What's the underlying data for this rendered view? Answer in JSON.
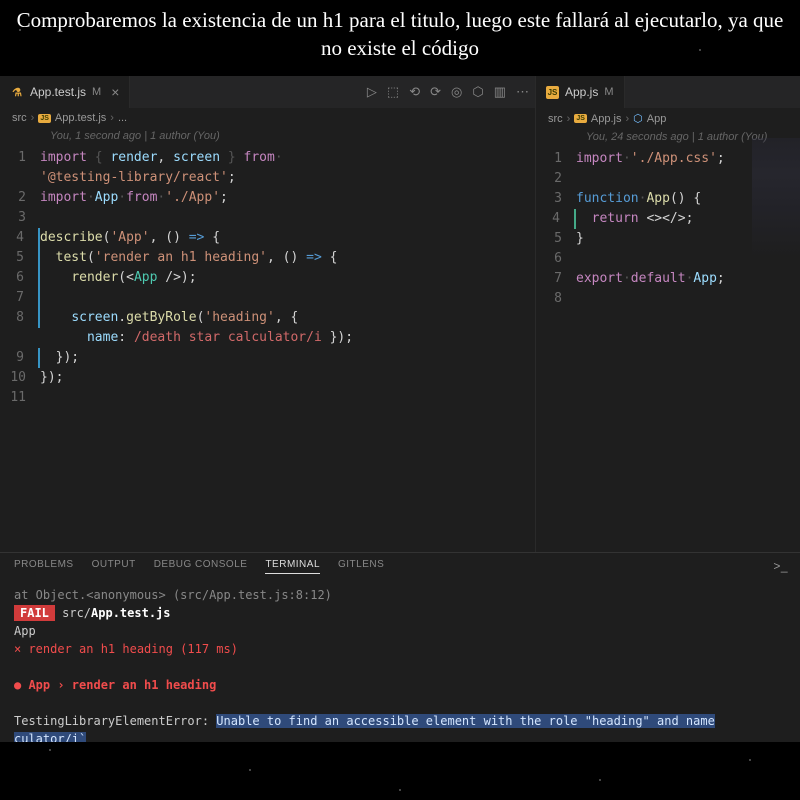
{
  "title": "Comprobaremos la existencia de un h1 para el titulo, luego este fallará al ejecutarlo, ya que no existe el código",
  "leftPane": {
    "tab": {
      "name": "App.test.js",
      "dirty": "M"
    },
    "breadcrumb": {
      "p1": "src",
      "p2": "App.test.js",
      "p3": "..."
    },
    "gitlens": "You, 1 second ago | 1 author (You)",
    "lines": [
      "1",
      "2",
      "3",
      "4",
      "5",
      "6",
      "7",
      "8",
      "9",
      "10",
      "11"
    ]
  },
  "rightPane": {
    "tab": {
      "name": "App.js",
      "dirty": "M"
    },
    "breadcrumb": {
      "p1": "src",
      "p2": "App.js",
      "p3": "App"
    },
    "gitlens": "You, 24 seconds ago | 1 author (You)",
    "lines": [
      "1",
      "2",
      "3",
      "4",
      "5",
      "6",
      "7",
      "8"
    ]
  },
  "panelTabs": {
    "problems": "PROBLEMS",
    "output": "OUTPUT",
    "debug": "DEBUG CONSOLE",
    "terminal": "TERMINAL",
    "gitlens": "GITLENS"
  },
  "terminal": {
    "l1a": "      at Object.<anonymous> (",
    "l1b": "src/App.test.js",
    "l1c": ":8:12)",
    "fail": "FAIL",
    "l2": " src/",
    "l2b": "App.test.js",
    "l3": "  App",
    "l4": "    × render an h1 heading (117 ms)",
    "l5": "  ● App › render an h1 heading",
    "l6a": "    TestingLibraryElementError: ",
    "l6b": "Unable to find an accessible element with the role \"heading\" and name",
    "l7": "culator/i`"
  },
  "code": {
    "left": {
      "l1": {
        "a": "import",
        "b": " { ",
        "c": "render",
        "d": ", ",
        "e": "screen",
        "f": " } ",
        "g": "from"
      },
      "l1b": {
        "a": "'@testing-library/react'",
        "b": ";"
      },
      "l2": {
        "a": "import",
        "b": " ",
        "c": "App",
        "d": " ",
        "e": "from",
        "f": " ",
        "g": "'./App'",
        "h": ";"
      },
      "l4": {
        "a": "describe",
        "b": "(",
        "c": "'App'",
        "d": ", () ",
        "e": "=>",
        "f": " {"
      },
      "l5": {
        "a": "  ",
        "b": "test",
        "c": "(",
        "d": "'render an h1 heading'",
        "e": ", () ",
        "f": "=>",
        "g": " {"
      },
      "l6": {
        "a": "    ",
        "b": "render",
        "c": "(<",
        "d": "App",
        "e": " />);"
      },
      "l8": {
        "a": "    ",
        "b": "screen",
        "c": ".",
        "d": "getByRole",
        "e": "(",
        "f": "'heading'",
        "g": ", {"
      },
      "l8b": {
        "a": "      ",
        "b": "name",
        "c": ": ",
        "d": "/death star calculator/i",
        "e": " });"
      },
      "l9": {
        "a": "  });"
      },
      "l10": {
        "a": "});"
      }
    },
    "right": {
      "l1": {
        "a": "import",
        "b": " ",
        "c": "'./App.css'",
        "d": ";"
      },
      "l3": {
        "a": "function",
        "b": " ",
        "c": "App",
        "d": "() {"
      },
      "l4": {
        "a": "  ",
        "b": "return",
        "c": " <></>;"
      },
      "l5": {
        "a": "}"
      },
      "l7": {
        "a": "export",
        "b": " ",
        "c": "default",
        "d": " ",
        "e": "App",
        "f": ";"
      }
    }
  }
}
